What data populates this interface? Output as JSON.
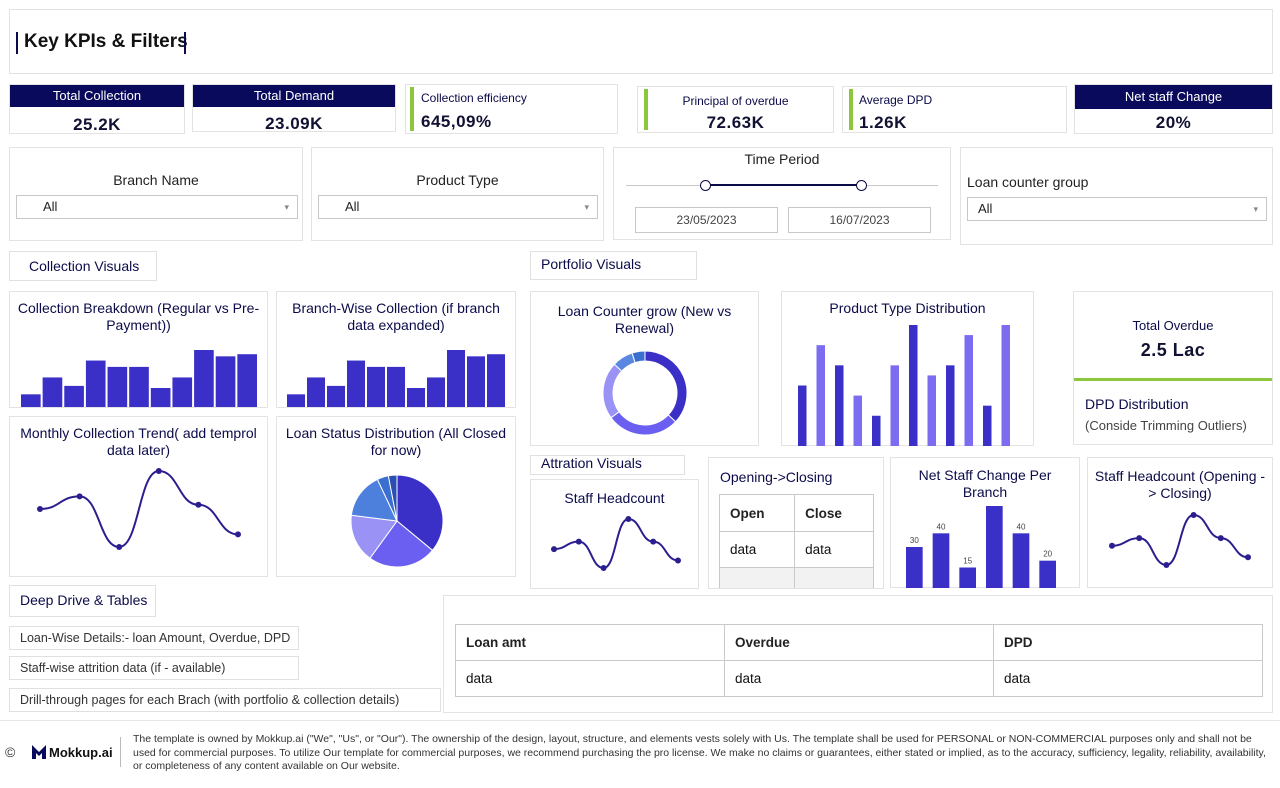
{
  "header": {
    "title": "Key KPIs & Filters"
  },
  "kpis": {
    "total_collection": {
      "label": "Total Collection",
      "value": "25.2K"
    },
    "total_demand": {
      "label": "Total Demand",
      "value": "23.09K"
    },
    "collection_efficiency": {
      "label": "Collection efficiency",
      "value": "645,09%"
    },
    "principal_overdue": {
      "label": "Principal of overdue",
      "value": "72.63K"
    },
    "average_dpd": {
      "label": "Average DPD",
      "value": "1.26K"
    },
    "net_staff_change": {
      "label": "Net staff Change",
      "value": "20%"
    }
  },
  "filters": {
    "branch": {
      "label": "Branch Name",
      "value": "All"
    },
    "product": {
      "label": "Product Type",
      "value": "All"
    },
    "time_period": {
      "label": "Time Period",
      "start": "23/05/2023",
      "end": "16/07/2023"
    },
    "loan_counter": {
      "label": "Loan counter group",
      "value": "All"
    }
  },
  "sections": {
    "collection": "Collection Visuals",
    "portfolio": "Portfolio Visuals",
    "attrition": "Attration Visuals",
    "deep_drive": "Deep Drive & Tables"
  },
  "charts": {
    "collection_breakdown": "Collection Breakdown (Regular vs Pre-Payment))",
    "branch_wise": "Branch-Wise Collection (if branch data expanded)",
    "monthly_trend": "Monthly Collection Trend( add temprol data later)",
    "loan_status": "Loan Status Distribution (All Closed for now)",
    "loan_counter_grow": "Loan Counter grow (New vs Renewal)",
    "product_type_dist": "Product Type Distribution",
    "staff_headcount": "Staff Headcount",
    "opening_closing": "Opening->Closing",
    "net_staff_per_branch": "Net Staff Change Per Branch",
    "staff_headcount_oc": "Staff Headcount (Opening -> Closing)"
  },
  "total_overdue": {
    "label": "Total Overdue",
    "value": "2.5 Lac"
  },
  "dpd_distribution": {
    "label": "DPD Distribution",
    "note": "(Conside Trimming Outliers)"
  },
  "opening_closing_table": {
    "headers": [
      "Open",
      "Close"
    ],
    "row": [
      "data",
      "data"
    ]
  },
  "deep_list": [
    "Loan-Wise Details:- loan Amount, Overdue, DPD",
    "Staff-wise attrition data (if - available)",
    "Drill-through pages for each Brach (with portfolio & collection details)"
  ],
  "loan_table": {
    "headers": [
      "Loan amt",
      "Overdue",
      "DPD"
    ],
    "row": [
      "data",
      "data",
      "data"
    ]
  },
  "footer": {
    "copyright": "©",
    "brand": "Mokkup.ai",
    "text": "The template is owned by Mokkup.ai (\"We\", \"Us\", or \"Our\"). The ownership of the design, layout, structure, and elements vests solely with Us. The template shall be used for PERSONAL or NON-COMMERCIAL purposes only and shall not be used for commercial purposes. To utilize Our template for commercial purposes, we recommend purchasing the pro license. We make no claims or guarantees, either stated or implied, as to the accuracy, sufficiency, legality, reliability, availability, or completeness of any content available on Our website."
  },
  "colors": {
    "navy": "#0a0a5c",
    "green": "#8cc63f",
    "bar": "#3a2fc7",
    "bar_light": "#7b6cf0"
  },
  "chart_data": [
    {
      "type": "bar",
      "name_ref": "collection_breakdown",
      "values": [
        3,
        7,
        5,
        11,
        9.5,
        9.5,
        4.5,
        7,
        13.5,
        12,
        12.5
      ]
    },
    {
      "type": "bar",
      "name_ref": "branch_wise",
      "values": [
        3,
        7,
        5,
        11,
        9.5,
        9.5,
        4.5,
        7,
        13.5,
        12,
        12.5
      ]
    },
    {
      "type": "line",
      "name_ref": "monthly_trend",
      "values": [
        5,
        6.5,
        0.5,
        9.5,
        5.5,
        2
      ]
    },
    {
      "type": "pie",
      "name_ref": "loan_status",
      "values": [
        36,
        24,
        17,
        16,
        4,
        3
      ]
    },
    {
      "type": "pie",
      "name_ref": "loan_counter_grow",
      "values": [
        37,
        28,
        22,
        8,
        5
      ]
    },
    {
      "type": "bar",
      "name_ref": "product_type_dist",
      "values": [
        6,
        10,
        8,
        5,
        3,
        8,
        12,
        7,
        8,
        11,
        4,
        12
      ]
    },
    {
      "type": "line",
      "name_ref": "staff_headcount",
      "values": [
        4,
        5,
        1.5,
        8,
        5,
        2.5
      ]
    },
    {
      "type": "bar",
      "name_ref": "net_staff_per_branch",
      "values": [
        30,
        40,
        15,
        60,
        40,
        20
      ],
      "labels": [
        "30",
        "40",
        "15",
        "",
        "40",
        "20"
      ]
    },
    {
      "type": "line",
      "name_ref": "staff_headcount_oc",
      "values": [
        4,
        5,
        1.5,
        8,
        5,
        2.5
      ]
    }
  ]
}
